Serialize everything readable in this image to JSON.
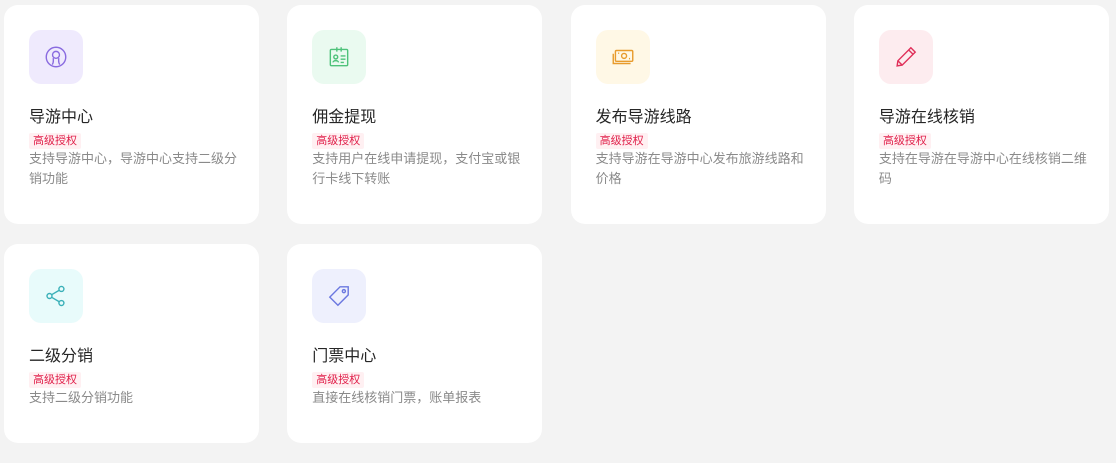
{
  "cards": [
    {
      "title": "导游中心",
      "badge": "高级授权",
      "desc": "支持导游中心，导游中心支持二级分销功能",
      "icon": "user-circle-icon",
      "icon_color": "#8a6be0",
      "icon_bg": "#efeafd"
    },
    {
      "title": "佣金提现",
      "badge": "高级授权",
      "desc": "支持用户在线申请提现，支付宝或银行卡线下转账",
      "icon": "id-card-icon",
      "icon_color": "#4ec27a",
      "icon_bg": "#eafaf0"
    },
    {
      "title": "发布导游线路",
      "badge": "高级授权",
      "desc": "支持导游在导游中心发布旅游线路和价格",
      "icon": "money-icon",
      "icon_color": "#e89b2c",
      "icon_bg": "#fff8e6"
    },
    {
      "title": "导游在线核销",
      "badge": "高级授权",
      "desc": "支持在导游在导游中心在线核销二维码",
      "icon": "pencil-icon",
      "icon_color": "#e0305a",
      "icon_bg": "#fdecef"
    },
    {
      "title": "二级分销",
      "badge": "高级授权",
      "desc": "支持二级分销功能",
      "icon": "share-icon",
      "icon_color": "#3ab0b8",
      "icon_bg": "#e8fbfb"
    },
    {
      "title": "门票中心",
      "badge": "高级授权",
      "desc": "直接在线核销门票，账单报表",
      "icon": "tag-icon",
      "icon_color": "#6b78e0",
      "icon_bg": "#eef0fd"
    }
  ]
}
